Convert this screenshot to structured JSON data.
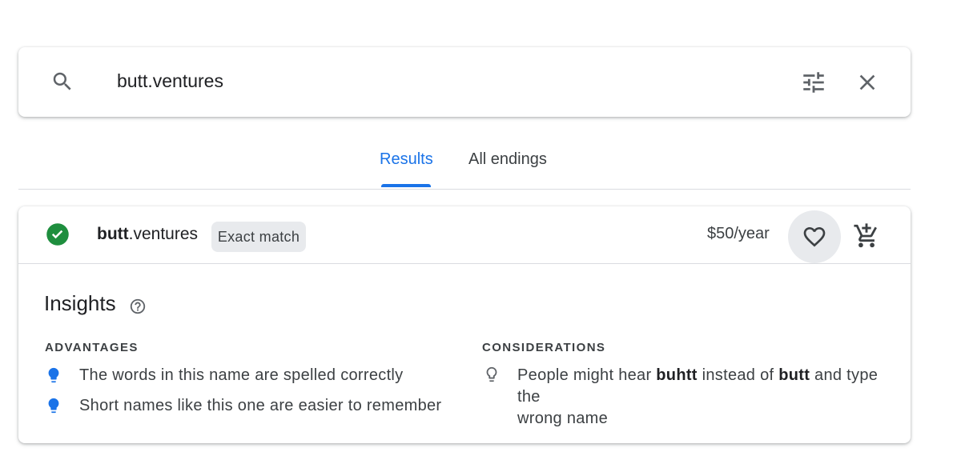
{
  "search": {
    "query": "butt.ventures"
  },
  "tabs": [
    {
      "label": "Results",
      "active": true
    },
    {
      "label": "All endings",
      "active": false
    }
  ],
  "result": {
    "domain_name": "butt",
    "domain_tld": ".ventures",
    "badge": "Exact match",
    "price": "$50/year",
    "status_icon": "check-circle-icon",
    "status_color": "#1e8e3e"
  },
  "insights": {
    "title": "Insights",
    "advantages_heading": "ADVANTAGES",
    "advantages": [
      "The words in this name are spelled correctly",
      "Short names like this one are easier to remember"
    ],
    "considerations_heading": "CONSIDERATIONS",
    "consideration": {
      "part1": "People might hear ",
      "bold1": "buhtt",
      "part2": " instead of ",
      "bold2": "butt",
      "part3": " and type the",
      "line2": "wrong name"
    }
  },
  "colors": {
    "accent": "#1a73e8",
    "success": "#1e8e3e",
    "badge_bg": "#e8eaed"
  }
}
